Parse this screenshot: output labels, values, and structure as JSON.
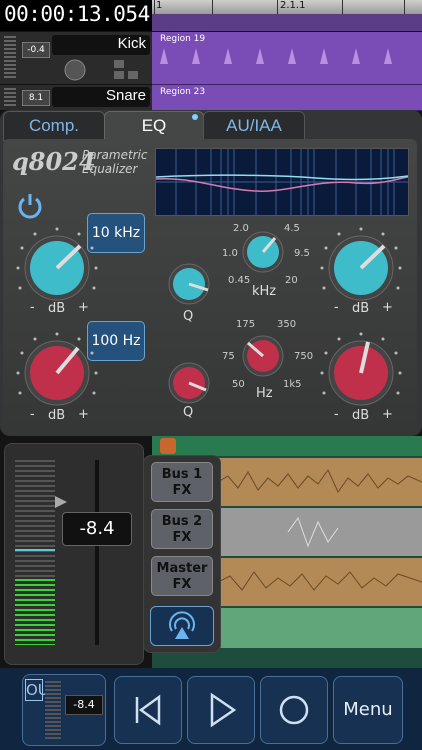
{
  "transport": {
    "time": "00:00:13.054"
  },
  "ruler": {
    "marks": [
      "1",
      "2.1.1"
    ]
  },
  "tracks": [
    {
      "name": "Kick",
      "volume": "-0.4",
      "region": "Region 19"
    },
    {
      "name": "Snare",
      "volume": "8.1",
      "region": "Region 23"
    }
  ],
  "tabs": [
    "Comp.",
    "EQ",
    "AU/IAA"
  ],
  "eq": {
    "logo": "q8024",
    "subtitle_line1": "Parametric",
    "subtitle_line2": "Equalizer",
    "high_freq": "10 kHz",
    "low_freq": "100 Hz",
    "db_label": "dB",
    "minus": "-",
    "plus": "+",
    "q_label": "Q",
    "khz_label": "kHz",
    "hz_label": "Hz",
    "khz_scale": [
      "2.0",
      "4.5",
      "1.0",
      "9.5",
      "0.45",
      "20"
    ],
    "hz_scale": [
      "175",
      "350",
      "75",
      "750",
      "50",
      "1k5"
    ]
  },
  "mixer": {
    "volume": "-8.4"
  },
  "fx": {
    "bus1_line1": "Bus 1",
    "bus1_line2": "FX",
    "bus2_line1": "Bus 2",
    "bus2_line2": "FX",
    "master_line1": "Master",
    "master_line2": "FX"
  },
  "bottom": {
    "out_label": "OUT",
    "out_volume": "-8.4",
    "menu_label": "Menu"
  },
  "colors": {
    "accent_teal": "#3fbcc9",
    "accent_red": "#c0304a",
    "button_blue": "#24527c",
    "region_purple": "#7a4cb5",
    "track_green": "#2e8a5e"
  }
}
